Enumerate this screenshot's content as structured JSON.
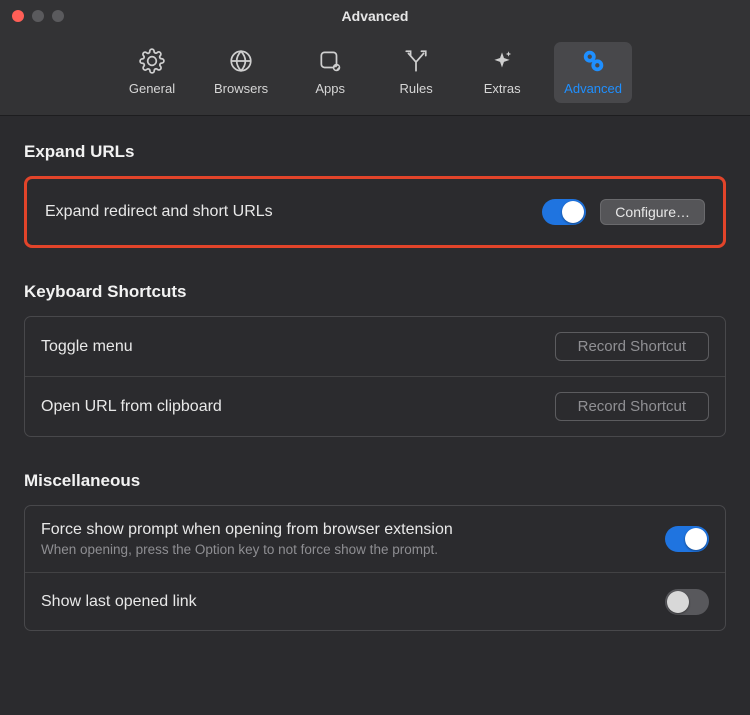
{
  "window": {
    "title": "Advanced"
  },
  "tabs": [
    {
      "label": "General"
    },
    {
      "label": "Browsers"
    },
    {
      "label": "Apps"
    },
    {
      "label": "Rules"
    },
    {
      "label": "Extras"
    },
    {
      "label": "Advanced"
    }
  ],
  "sections": {
    "expandUrls": {
      "title": "Expand URLs",
      "row": {
        "label": "Expand redirect and short URLs",
        "toggle": true,
        "button": "Configure…"
      }
    },
    "shortcuts": {
      "title": "Keyboard Shortcuts",
      "rows": [
        {
          "label": "Toggle menu",
          "button": "Record Shortcut"
        },
        {
          "label": "Open URL from clipboard",
          "button": "Record Shortcut"
        }
      ]
    },
    "misc": {
      "title": "Miscellaneous",
      "rows": [
        {
          "label": "Force show prompt when opening from browser extension",
          "sublabel": "When opening, press the Option key to not force show the prompt.",
          "toggle": true
        },
        {
          "label": "Show last opened link",
          "toggle": false
        }
      ]
    }
  }
}
